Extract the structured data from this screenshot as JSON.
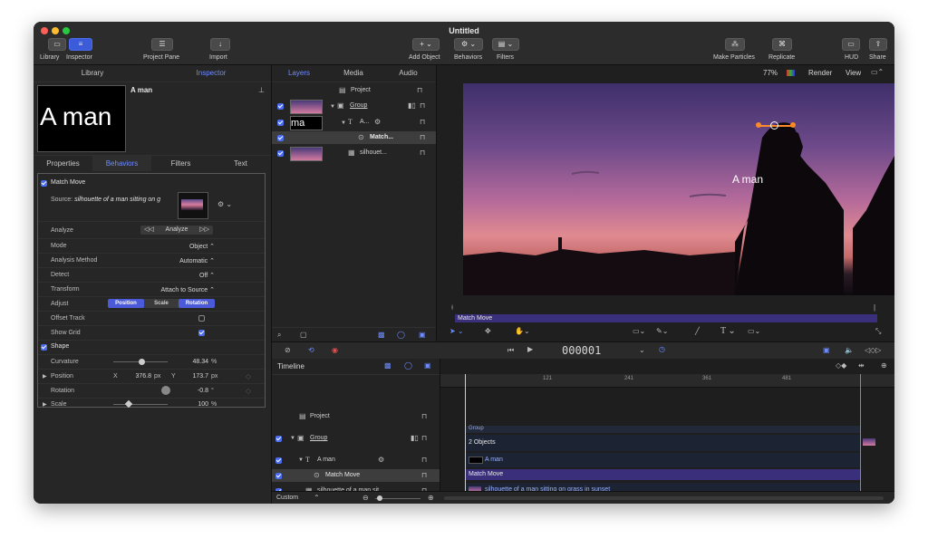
{
  "window": {
    "title": "Untitled"
  },
  "toolbar": {
    "library": "Library",
    "inspector": "Inspector",
    "project_pane": "Project Pane",
    "import": "Import",
    "add_object": "Add Object",
    "behaviors": "Behaviors",
    "filters": "Filters",
    "make_particles": "Make Particles",
    "replicate": "Replicate",
    "hud": "HUD",
    "share": "Share"
  },
  "left_panel": {
    "tabs": [
      "Library",
      "Inspector"
    ],
    "preview_text": "A man",
    "object_name": "A man",
    "sub_tabs": [
      "Properties",
      "Behaviors",
      "Filters",
      "Text"
    ],
    "match_move": {
      "header": "Match Move",
      "source_label": "Source:",
      "source_value": "silhouette of a man sitting on g",
      "rows": [
        {
          "label": "Analyze",
          "value": "Analyze"
        },
        {
          "label": "Mode",
          "value": "Object ⌃"
        },
        {
          "label": "Analysis Method",
          "value": "Automatic ⌃"
        },
        {
          "label": "Detect",
          "value": "Off ⌃"
        },
        {
          "label": "Transform",
          "value": "Attach to Source ⌃"
        }
      ],
      "adjust_label": "Adjust",
      "adjust_options": [
        "Position",
        "Scale",
        "Rotation"
      ],
      "offset_track": "Offset Track",
      "show_grid": "Show Grid"
    },
    "shape": {
      "header": "Shape",
      "curvature_label": "Curvature",
      "curvature_value": "48.34",
      "curvature_unit": "%",
      "position_label": "Position",
      "pos_x_label": "X",
      "pos_x": "376.8",
      "pos_y_label": "Y",
      "pos_y": "173.7",
      "px": "px",
      "rotation_label": "Rotation",
      "rotation_value": "-0.8",
      "rotation_unit": "°",
      "scale_label": "Scale",
      "scale_value": "100",
      "scale_unit": "%"
    }
  },
  "layers": {
    "tabs": [
      "Layers",
      "Media",
      "Audio"
    ],
    "items": [
      {
        "name": "Project"
      },
      {
        "name": "Group"
      },
      {
        "name": "A..."
      },
      {
        "name": "Match..."
      },
      {
        "name": "silhouet..."
      }
    ],
    "thumb_text": "ma"
  },
  "canvas": {
    "zoom": "77%",
    "render": "Render",
    "view": "View",
    "overlay_text": "A man",
    "mini_track": "Match Move"
  },
  "transport": {
    "timecode": "000001"
  },
  "timeline": {
    "label": "Timeline",
    "rows": [
      "Project",
      "Group",
      "A man",
      "Match Move",
      "silhouette of a man sit..."
    ],
    "ruler": [
      "121",
      "241",
      "361",
      "481"
    ],
    "tracks": {
      "group": "Group",
      "objects": "2 Objects",
      "aman": "A man",
      "matchmove": "Match Move",
      "silhouette": "silhouette of a man sitting on grass in sunset"
    },
    "footer": "Custom"
  },
  "colors": {
    "accent": "#4a6cf0",
    "selected_row": "#3d3d3d",
    "purple_track": "#3a2f7a"
  }
}
